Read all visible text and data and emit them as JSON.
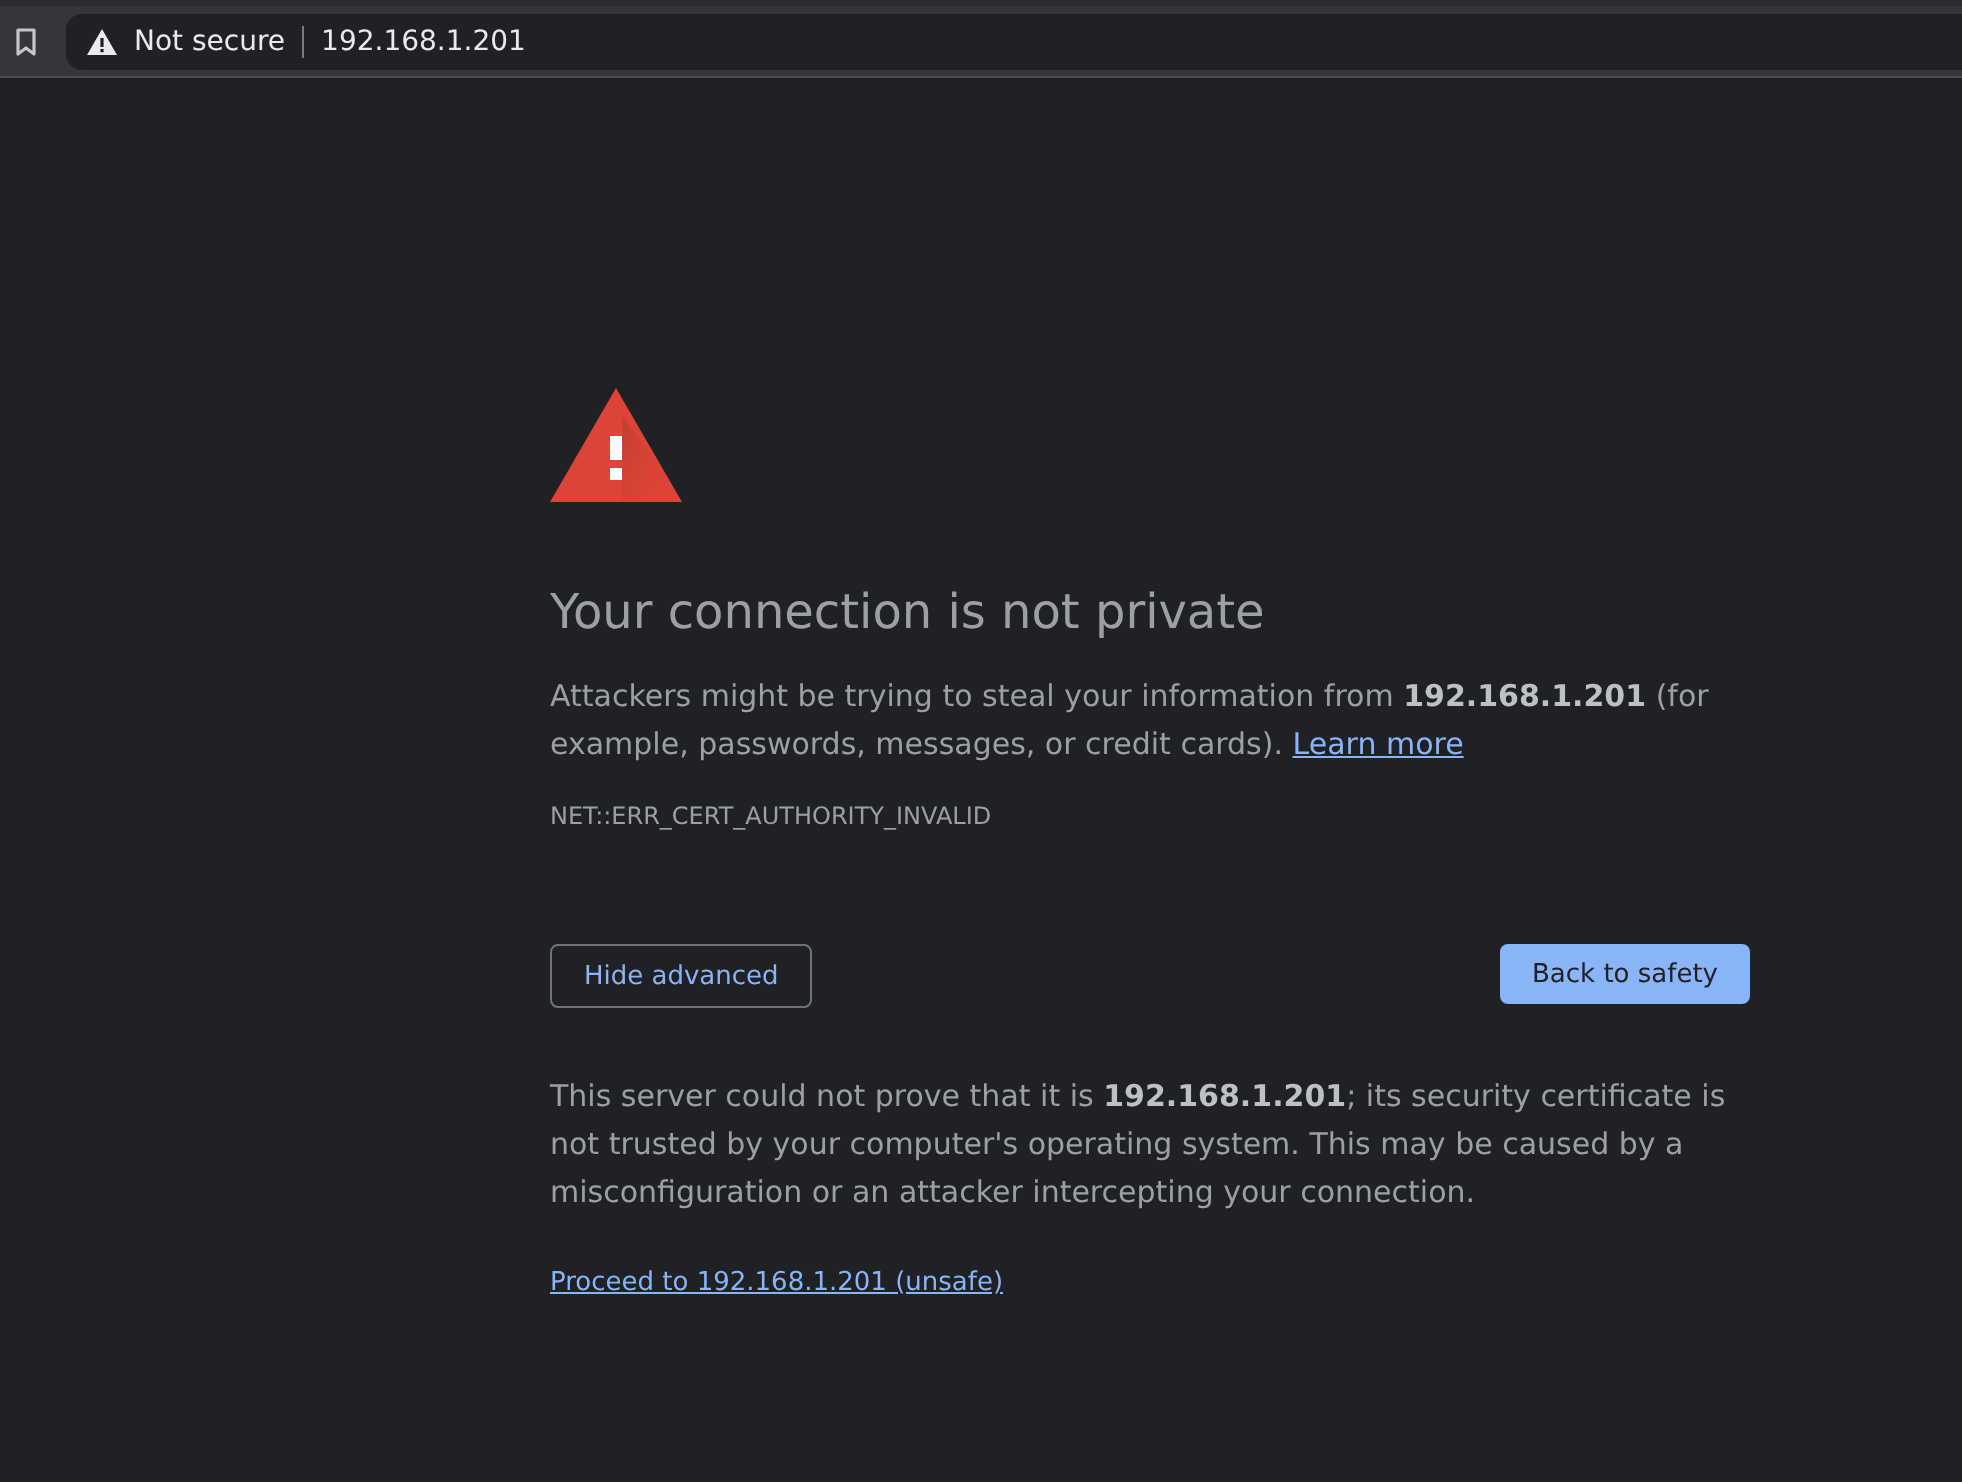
{
  "browser_toolbar": {
    "security_label": "Not secure",
    "address": "192.168.1.201"
  },
  "interstitial": {
    "heading": "Your connection is not private",
    "message": "Attackers might be trying to steal your information from **192.168.1.201** (for example, passwords, messages, or credit cards).",
    "learn_more_link": "Learn more",
    "error_code": "NET::ERR_CERT_AUTHORITY_INVALID",
    "buttons": [
      {
        "label": "Hide advanced",
        "kind": "secondary"
      },
      {
        "label": "Back to safety",
        "kind": "primary"
      }
    ],
    "details": "This server could not prove that it is **192.168.1.201**; its security certificate is not trusted by your computer's operating system. This may be caused by a misconfiguration or an attacker intercepting your connection.",
    "proceed_link": "Proceed to 192.168.1.201 (unsafe)"
  }
}
